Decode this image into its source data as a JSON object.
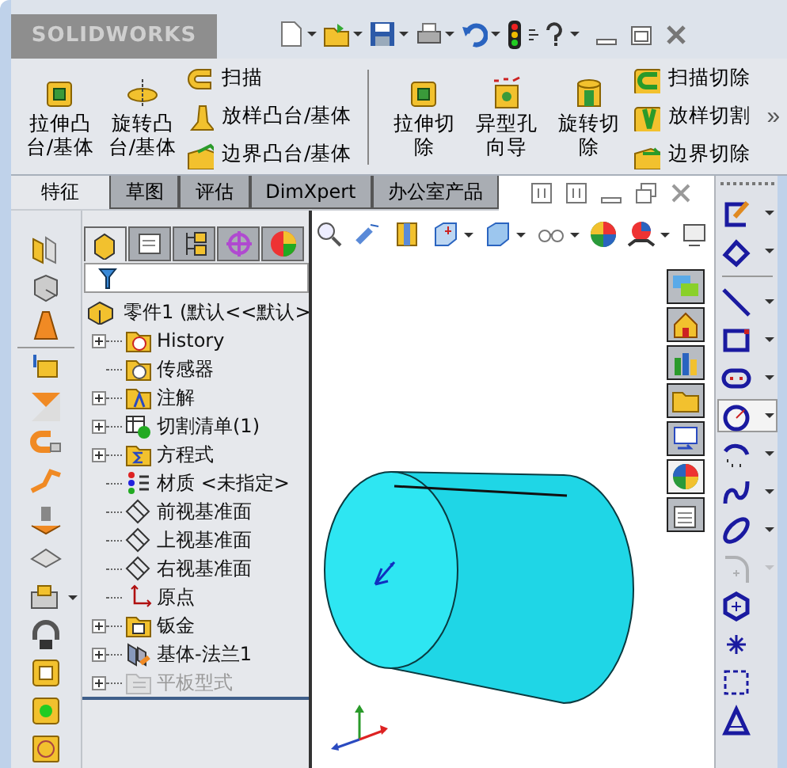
{
  "window": {
    "logo": "SOLIDWORKS"
  },
  "ribbon": {
    "groups": [
      {
        "large": [
          {
            "lines": [
              "拉伸凸",
              "台/基体"
            ]
          },
          {
            "lines": [
              "旋转凸",
              "台/基体"
            ]
          }
        ],
        "small": [
          {
            "label": "扫描"
          },
          {
            "label": "放样凸台/基体"
          },
          {
            "label": "边界凸台/基体"
          }
        ]
      },
      {
        "large": [
          {
            "lines": [
              "拉伸切",
              "除"
            ]
          },
          {
            "lines": [
              "异型孔",
              "向导"
            ]
          },
          {
            "lines": [
              "旋转切",
              "除"
            ]
          }
        ],
        "small": [
          {
            "label": "扫描切除"
          },
          {
            "label": "放样切割"
          },
          {
            "label": "边界切除"
          }
        ]
      }
    ],
    "more": "»"
  },
  "tabs": [
    {
      "label": "特征",
      "selected": true
    },
    {
      "label": "草图",
      "selected": false
    },
    {
      "label": "评估",
      "selected": false
    },
    {
      "label": "DimXpert",
      "selected": false
    },
    {
      "label": "办公室产品",
      "selected": false
    }
  ],
  "feature_manager": {
    "tabs": [
      {
        "selected": true
      },
      {
        "selected": false
      },
      {
        "selected": false
      },
      {
        "selected": false
      },
      {
        "selected": false
      }
    ],
    "tree": {
      "label": "零件1 (默认<<默认>",
      "children": [
        {
          "label": "History",
          "expander": true,
          "disabled": false
        },
        {
          "label": "传感器",
          "expander": false,
          "disabled": false
        },
        {
          "label": "注解",
          "expander": true,
          "disabled": false
        },
        {
          "label": "切割清单(1)",
          "expander": true,
          "disabled": false
        },
        {
          "label": "方程式",
          "expander": true,
          "disabled": false
        },
        {
          "label": "材质 <未指定>",
          "expander": false,
          "disabled": false
        },
        {
          "label": "前视基准面",
          "expander": false,
          "disabled": false
        },
        {
          "label": "上视基准面",
          "expander": false,
          "disabled": false
        },
        {
          "label": "右视基准面",
          "expander": false,
          "disabled": false
        },
        {
          "label": "原点",
          "expander": false,
          "disabled": false
        },
        {
          "label": "钣金",
          "expander": true,
          "disabled": false
        },
        {
          "label": "基体-法兰1",
          "expander": true,
          "disabled": false
        },
        {
          "label": "平板型式",
          "expander": true,
          "disabled": true
        }
      ]
    }
  },
  "task_pane": [
    {
      "selected": false
    },
    {
      "selected": false
    },
    {
      "selected": false
    },
    {
      "selected": false
    },
    {
      "selected": false
    },
    {
      "selected": true
    },
    {
      "selected": false
    }
  ],
  "sketch_tools": [
    {
      "selected": false,
      "dropdown": true,
      "disabled": false
    },
    {
      "selected": false,
      "dropdown": true,
      "disabled": false
    },
    {
      "selected": false,
      "dropdown": true,
      "disabled": false
    },
    {
      "selected": false,
      "dropdown": true,
      "disabled": false
    },
    {
      "selected": false,
      "dropdown": true,
      "disabled": false
    },
    {
      "selected": true,
      "dropdown": true,
      "disabled": false
    },
    {
      "selected": false,
      "dropdown": true,
      "disabled": false
    },
    {
      "selected": false,
      "dropdown": true,
      "disabled": false
    },
    {
      "selected": false,
      "dropdown": true,
      "disabled": false
    },
    {
      "selected": false,
      "dropdown": true,
      "disabled": true
    },
    {
      "selected": false,
      "dropdown": false,
      "disabled": false
    },
    {
      "selected": false,
      "dropdown": false,
      "disabled": false
    },
    {
      "selected": false,
      "dropdown": false,
      "disabled": false
    },
    {
      "selected": false,
      "dropdown": false,
      "disabled": false
    }
  ]
}
